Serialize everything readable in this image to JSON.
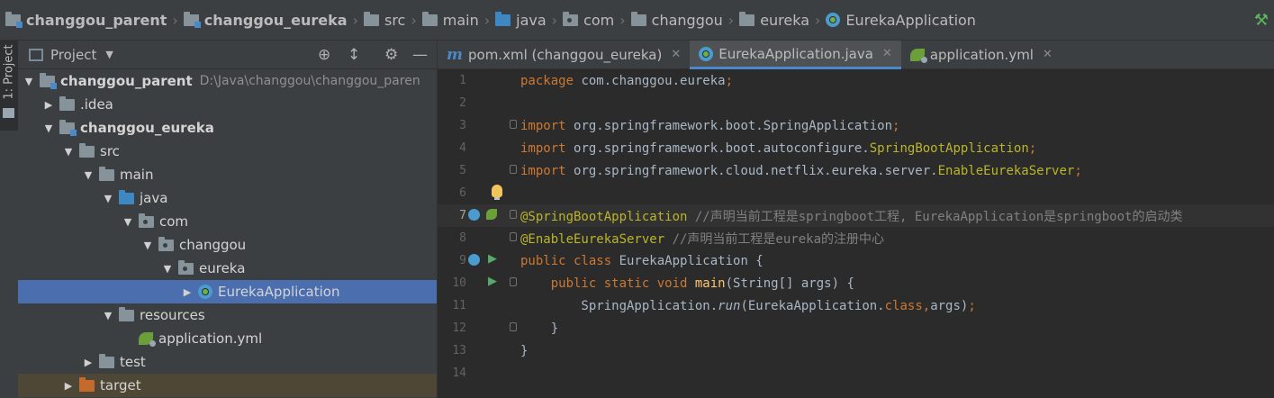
{
  "breadcrumbs": [
    {
      "label": "changgou_parent",
      "icon": "module-folder-icon"
    },
    {
      "label": "changgou_eureka",
      "icon": "module-folder-icon"
    },
    {
      "label": "src",
      "icon": "folder-icon"
    },
    {
      "label": "main",
      "icon": "folder-icon"
    },
    {
      "label": "java",
      "icon": "source-folder-icon"
    },
    {
      "label": "com",
      "icon": "package-icon"
    },
    {
      "label": "changgou",
      "icon": "folder-icon"
    },
    {
      "label": "eureka",
      "icon": "folder-icon"
    },
    {
      "label": "EurekaApplication",
      "icon": "spring-class-icon"
    }
  ],
  "tool_strip": {
    "project_tab": "1: Project"
  },
  "project_panel": {
    "title": "Project",
    "tree": [
      {
        "label": "changgou_parent",
        "path": "D:\\Java\\changgou\\changgou_paren",
        "depth": 0,
        "expanded": true,
        "bold": true,
        "icon": "module-folder-icon"
      },
      {
        "label": ".idea",
        "depth": 1,
        "expanded": false,
        "icon": "folder-icon"
      },
      {
        "label": "changgou_eureka",
        "depth": 1,
        "expanded": true,
        "bold": true,
        "icon": "module-folder-icon"
      },
      {
        "label": "src",
        "depth": 2,
        "expanded": true,
        "icon": "folder-icon"
      },
      {
        "label": "main",
        "depth": 3,
        "expanded": true,
        "icon": "folder-icon"
      },
      {
        "label": "java",
        "depth": 4,
        "expanded": true,
        "icon": "source-folder-icon"
      },
      {
        "label": "com",
        "depth": 5,
        "expanded": true,
        "icon": "package-icon"
      },
      {
        "label": "changgou",
        "depth": 6,
        "expanded": true,
        "icon": "package-icon"
      },
      {
        "label": "eureka",
        "depth": 7,
        "expanded": true,
        "icon": "package-icon"
      },
      {
        "label": "EurekaApplication",
        "depth": 8,
        "expanded": false,
        "selected": true,
        "icon": "spring-class-icon"
      },
      {
        "label": "resources",
        "depth": 4,
        "expanded": true,
        "icon": "resources-folder-icon"
      },
      {
        "label": "application.yml",
        "depth": 5,
        "leaf": true,
        "icon": "yml-file-icon"
      },
      {
        "label": "test",
        "depth": 3,
        "expanded": false,
        "icon": "folder-icon"
      },
      {
        "label": "target",
        "depth": 2,
        "expanded": false,
        "icon": "excluded-folder-icon"
      }
    ]
  },
  "editor": {
    "tabs": [
      {
        "label": "pom.xml (changgou_eureka)",
        "icon": "maven-icon",
        "active": false
      },
      {
        "label": "EurekaApplication.java",
        "icon": "spring-class-icon",
        "active": true
      },
      {
        "label": "application.yml",
        "icon": "yml-file-icon",
        "active": false
      }
    ],
    "current_line": 7,
    "lines": [
      {
        "no": "1",
        "tokens": [
          {
            "t": "package ",
            "c": "kw"
          },
          {
            "t": "com.changgou.eureka",
            "c": ""
          },
          {
            "t": ";",
            "c": "kw"
          }
        ]
      },
      {
        "no": "2",
        "tokens": []
      },
      {
        "no": "3",
        "tokens": [
          {
            "t": "import ",
            "c": "kw"
          },
          {
            "t": "org.springframework.boot.SpringApplication",
            "c": ""
          },
          {
            "t": ";",
            "c": "kw"
          }
        ],
        "fold": true
      },
      {
        "no": "4",
        "tokens": [
          {
            "t": "import ",
            "c": "kw"
          },
          {
            "t": "org.springframework.boot.autoconfigure.",
            "c": ""
          },
          {
            "t": "SpringBootApplication",
            "c": "cls"
          },
          {
            "t": ";",
            "c": "kw"
          }
        ]
      },
      {
        "no": "5",
        "tokens": [
          {
            "t": "import ",
            "c": "kw"
          },
          {
            "t": "org.springframework.cloud.netflix.eureka.server.",
            "c": ""
          },
          {
            "t": "EnableEurekaServer",
            "c": "cls"
          },
          {
            "t": ";",
            "c": "kw"
          }
        ],
        "fold": true
      },
      {
        "no": "6",
        "tokens": [],
        "bulb": true
      },
      {
        "no": "7",
        "tokens": [
          {
            "t": "@SpringBootApplication ",
            "c": "ann"
          },
          {
            "t": "//声明当前工程是springboot工程, EurekaApplication是springboot的启动类",
            "c": "cmt"
          }
        ],
        "fold": true,
        "gutter_icons": true
      },
      {
        "no": "8",
        "tokens": [
          {
            "t": "@EnableEurekaServer ",
            "c": "ann"
          },
          {
            "t": "//声明当前工程是eureka的注册中心",
            "c": "cmt"
          }
        ],
        "fold": true
      },
      {
        "no": "9",
        "tokens": [
          {
            "t": "public class ",
            "c": "kw"
          },
          {
            "t": "EurekaApplication {",
            "c": ""
          }
        ],
        "run": true,
        "spring_icon": true
      },
      {
        "no": "10",
        "tokens": [
          {
            "t": "    public static void ",
            "c": "kw"
          },
          {
            "t": "main",
            "c": "method"
          },
          {
            "t": "(String[] args) {",
            "c": ""
          }
        ],
        "run": true,
        "fold": true
      },
      {
        "no": "11",
        "tokens": [
          {
            "t": "        SpringApplication.",
            "c": ""
          },
          {
            "t": "run",
            "c": "italic"
          },
          {
            "t": "(EurekaApplication.",
            "c": ""
          },
          {
            "t": "class",
            "c": "kw"
          },
          {
            "t": ",",
            "c": "kw"
          },
          {
            "t": "args)",
            "c": ""
          },
          {
            "t": ";",
            "c": "kw"
          }
        ]
      },
      {
        "no": "12",
        "tokens": [
          {
            "t": "    }",
            "c": ""
          }
        ],
        "fold": true
      },
      {
        "no": "13",
        "tokens": [
          {
            "t": "}",
            "c": ""
          }
        ]
      },
      {
        "no": "14",
        "tokens": []
      }
    ]
  }
}
